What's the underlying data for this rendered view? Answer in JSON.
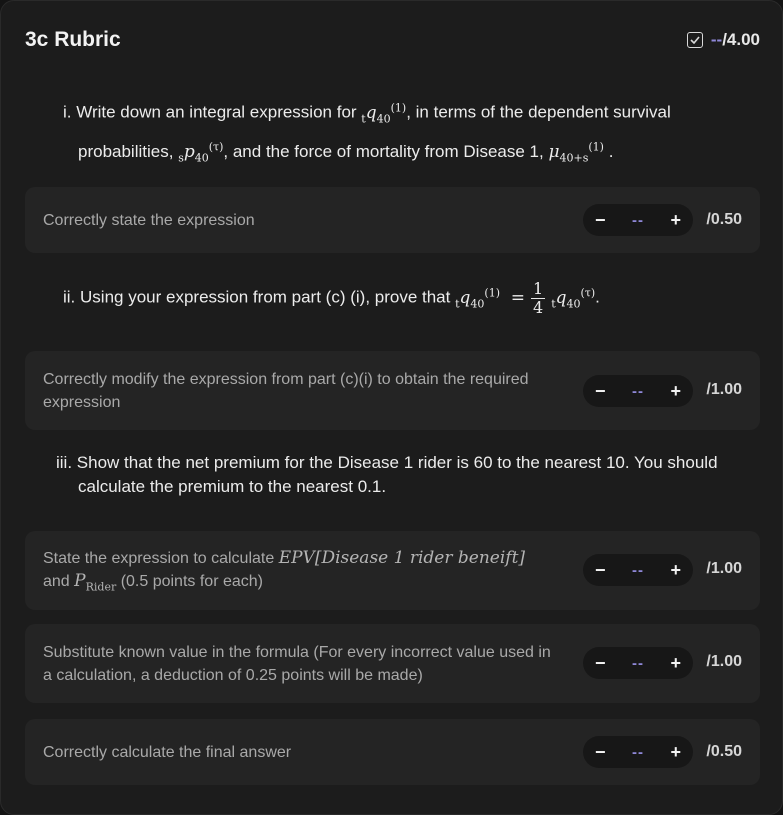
{
  "header": {
    "title": "3c Rubric",
    "total_score": "--",
    "total_max": "/4.00"
  },
  "questions": {
    "i": {
      "num": "i.",
      "text_1": "Write down an integral expression for",
      "text_2": ", in terms of the dependent survival",
      "text_3": "probabilities,",
      "text_4": ", and the force of mortality from Disease 1,",
      "text_5": "."
    },
    "ii": {
      "num": "ii.",
      "text_1": "Using your expression from part (c) (i), prove that"
    },
    "iii": {
      "num": "iii.",
      "text_1": "Show that the net premium for the Disease 1 rider is 60 to the nearest 10. You should",
      "text_2": "calculate the premium to the nearest 0.1."
    }
  },
  "criteria": [
    {
      "label": "Correctly state the expression",
      "score": "--",
      "max": "/0.50"
    },
    {
      "label": "Correctly modify the expression from part (c)(i) to obtain the required expression",
      "score": "--",
      "max": "/1.00"
    },
    {
      "label_1": "State the expression to calculate",
      "label_math": "EPV[Disease 1 rider beneift]",
      "label_2": "and",
      "label_3": "(0.5 points for each)",
      "score": "--",
      "max": "/1.00"
    },
    {
      "label": "Substitute known value in the formula (For every incorrect value used in a calculation, a deduction of 0.25 points will be made)",
      "score": "--",
      "max": "/1.00"
    },
    {
      "label": "Correctly calculate the final answer",
      "score": "--",
      "max": "/0.50"
    }
  ],
  "controls": {
    "minus": "−",
    "plus": "+"
  },
  "icons": {
    "total": "checkbox-icon",
    "decrement": "minus-icon",
    "increment": "plus-icon"
  }
}
